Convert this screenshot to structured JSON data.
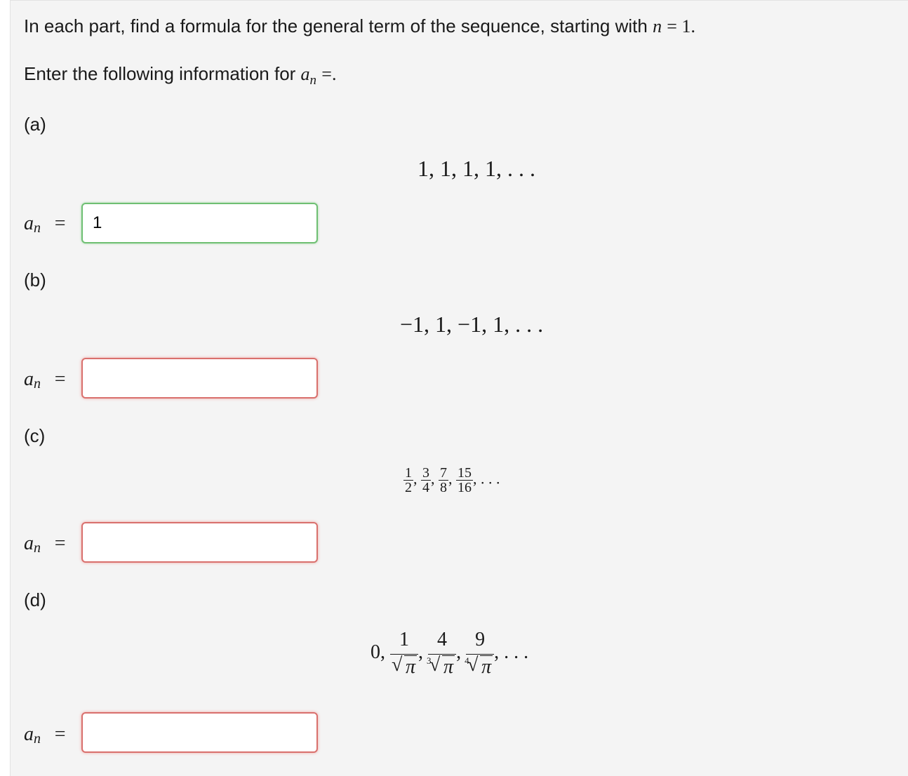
{
  "instructions": {
    "line1": "In each part, find a formula for the general term of the sequence, starting with ",
    "line1_math_n": "n",
    "line1_math_eq": "= 1.",
    "line2": "Enter the following information for ",
    "line2_math_a": "a",
    "line2_math_sub": "n",
    "line2_math_eq": "=."
  },
  "answer_label": {
    "a": "a",
    "sub": "n",
    "eq": "="
  },
  "parts": [
    {
      "label": "(a)",
      "sequence": "1, 1, 1, 1, . . .",
      "answer_value": "1",
      "status": "correct"
    },
    {
      "label": "(b)",
      "sequence": "−1, 1, −1, 1, . . .",
      "answer_value": "",
      "status": "incorrect"
    },
    {
      "label": "(c)",
      "sequence_terms": [
        {
          "num": "1",
          "den": "2"
        },
        {
          "num": "3",
          "den": "4"
        },
        {
          "num": "7",
          "den": "8"
        },
        {
          "num": "15",
          "den": "16"
        }
      ],
      "sequence_tail": ", . . .",
      "answer_value": "",
      "status": "incorrect"
    },
    {
      "label": "(d)",
      "sequence_lead": "0,",
      "sequence_terms": [
        {
          "num": "1",
          "radicand": "π",
          "index": ""
        },
        {
          "num": "4",
          "radicand": "π",
          "index": "3"
        },
        {
          "num": "9",
          "radicand": "π",
          "index": "4"
        }
      ],
      "sequence_tail": ", . . .",
      "answer_value": "",
      "status": "incorrect"
    }
  ],
  "colors": {
    "correct_border": "#6fbf73",
    "incorrect_border": "#d9706d",
    "panel_bg": "#f4f4f4"
  }
}
